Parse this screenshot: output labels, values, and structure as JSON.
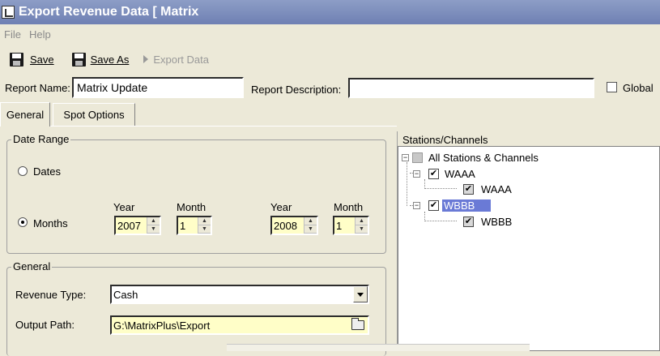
{
  "window": {
    "title": "Export Revenue Data [ Matrix"
  },
  "menu": {
    "file": "File",
    "help": "Help"
  },
  "toolbar": {
    "save": "Save",
    "save_as": "Save As",
    "export_data": "Export Data"
  },
  "report": {
    "name_label": "Report Name:",
    "name_value": "Matrix Update",
    "description_label": "Report Description:",
    "description_value": "",
    "global_label": "Global",
    "global_checked": false
  },
  "tabs": [
    {
      "label": "General",
      "active": true
    },
    {
      "label": "Spot Options",
      "active": false
    }
  ],
  "date_range": {
    "title": "Date Range",
    "dates_label": "Dates",
    "months_label": "Months",
    "selected": "Months",
    "start": {
      "year_label": "Year",
      "month_label": "Month",
      "year": "2007",
      "month": "1"
    },
    "end": {
      "year_label": "Year",
      "month_label": "Month",
      "year": "2008",
      "month": "1"
    }
  },
  "general": {
    "title": "General",
    "revenue_type_label": "Revenue Type:",
    "revenue_type_value": "Cash",
    "output_path_label": "Output Path:",
    "output_path_value": "G:\\MatrixPlus\\Export"
  },
  "stations": {
    "title": "Stations/Channels",
    "root": "All Stations & Channels",
    "items": [
      {
        "label": "WAAA",
        "child": "WAAA",
        "selected": false
      },
      {
        "label": "WBBB",
        "child": "WBBB",
        "selected": true
      }
    ]
  },
  "colors": {
    "title_bar": "#7c8cbd",
    "selection": "#6a7ad6",
    "field_yellow": "#fffec8"
  }
}
